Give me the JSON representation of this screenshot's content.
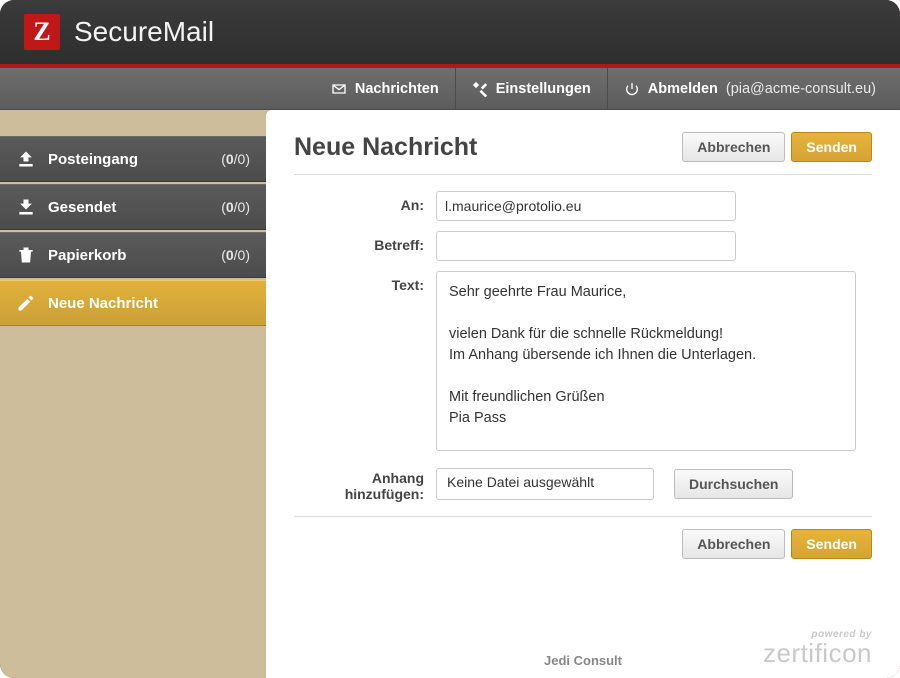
{
  "brand": {
    "badge": "Z",
    "title": "SecureMail"
  },
  "topmenu": {
    "messages": "Nachrichten",
    "settings": "Einstellungen",
    "logout": "Abmelden",
    "user_email": "(pia@acme-consult.eu)"
  },
  "sidebar": {
    "inbox": {
      "label": "Posteingang",
      "unread": "0",
      "total": "/0)"
    },
    "sent": {
      "label": "Gesendet",
      "unread": "0",
      "total": "/0)"
    },
    "trash": {
      "label": "Papierkorb",
      "unread": "0",
      "total": "/0)"
    },
    "compose": {
      "label": "Neue Nachricht"
    }
  },
  "page": {
    "title": "Neue Nachricht",
    "cancel": "Abbrechen",
    "send": "Senden"
  },
  "form": {
    "to_label": "An:",
    "to_value": "l.maurice@protolio.eu",
    "subject_label": "Betreff:",
    "subject_value": "",
    "text_label": "Text:",
    "text_value": "Sehr geehrte Frau Maurice,\n\nvielen Dank für die schnelle Rückmeldung!\nIm Anhang übersende ich Ihnen die Unterlagen.\n\nMit freundlichen Grüßen\nPia Pass",
    "attach_label": "Anhang hinzufügen:",
    "attach_value": "Keine Datei ausgewählt",
    "browse": "Durchsuchen"
  },
  "footer": {
    "tenant": "Jedi Consult",
    "powered_small": "powered by",
    "powered_big": "zertificon"
  }
}
